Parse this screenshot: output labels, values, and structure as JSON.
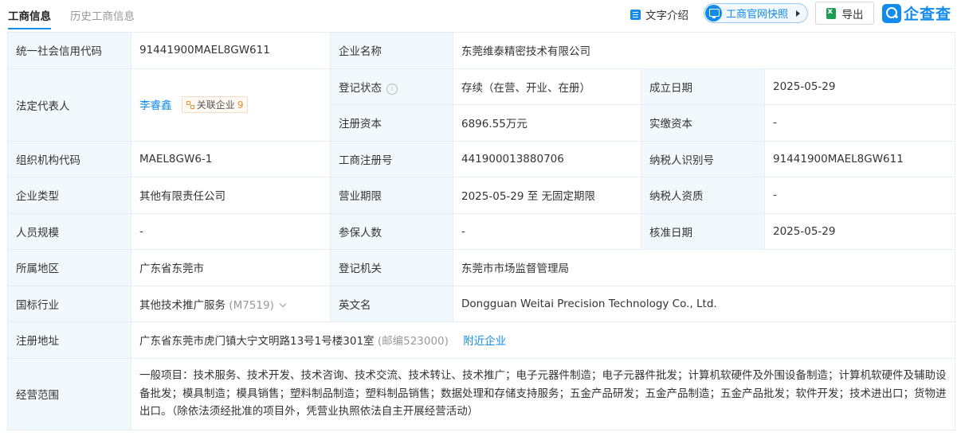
{
  "tabs": {
    "active": "工商信息",
    "inactive": "历史工商信息"
  },
  "toolbar": {
    "text_intro": "文字介绍",
    "snapshot": "工商官网快照",
    "export": "导出",
    "logo_text": "企查查"
  },
  "rows": {
    "credit_code": {
      "label": "统一社会信用代码",
      "value": "91441900MAEL8GW611"
    },
    "company_name": {
      "label": "企业名称",
      "value": "东莞维泰精密技术有限公司"
    },
    "legal_rep": {
      "label": "法定代表人",
      "value": "李睿鑫",
      "assoc_label": "关联企业",
      "assoc_count": "9"
    },
    "status": {
      "label": "登记状态",
      "value": "存续（在营、开业、在册）"
    },
    "founded": {
      "label": "成立日期",
      "value": "2025-05-29"
    },
    "reg_capital": {
      "label": "注册资本",
      "value": "6896.55万元"
    },
    "paid_capital": {
      "label": "实缴资本",
      "value": "-"
    },
    "org_code": {
      "label": "组织机构代码",
      "value": "MAEL8GW6-1"
    },
    "reg_no": {
      "label": "工商注册号",
      "value": "441900013880706"
    },
    "taxpayer_id": {
      "label": "纳税人识别号",
      "value": "91441900MAEL8GW611"
    },
    "company_type": {
      "label": "企业类型",
      "value": "其他有限责任公司"
    },
    "business_term": {
      "label": "营业期限",
      "value": "2025-05-29 至 无固定期限"
    },
    "taxpayer_qual": {
      "label": "纳税人资质",
      "value": "-"
    },
    "staff_size": {
      "label": "人员规模",
      "value": "-"
    },
    "insured": {
      "label": "参保人数",
      "value": "-"
    },
    "approved_date": {
      "label": "核准日期",
      "value": "2025-05-29"
    },
    "region": {
      "label": "所属地区",
      "value": "广东省东莞市"
    },
    "reg_authority": {
      "label": "登记机关",
      "value": "东莞市市场监督管理局"
    },
    "industry": {
      "label": "国标行业",
      "value": "其他技术推广服务",
      "code": "(M7519)"
    },
    "english_name": {
      "label": "英文名",
      "value": "Dongguan Weitai Precision Technology Co., Ltd."
    },
    "address": {
      "label": "注册地址",
      "value": "广东省东莞市虎门镇大宁文明路13号1号楼301室",
      "postcode": "(邮编523000)",
      "nearby": "附近企业"
    },
    "scope": {
      "label": "经营范围",
      "value": "一般项目：技术服务、技术开发、技术咨询、技术交流、技术转让、技术推广；电子元器件制造；电子元器件批发；计算机软硬件及外围设备制造；计算机软硬件及辅助设备批发；模具制造；模具销售；塑料制品制造；塑料制品销售；数据处理和存储支持服务；五金产品研发；五金产品制造；五金产品批发；软件开发；技术进出口；货物进出口。（除依法须经批准的项目外，凭营业执照依法自主开展经营活动）"
    }
  }
}
